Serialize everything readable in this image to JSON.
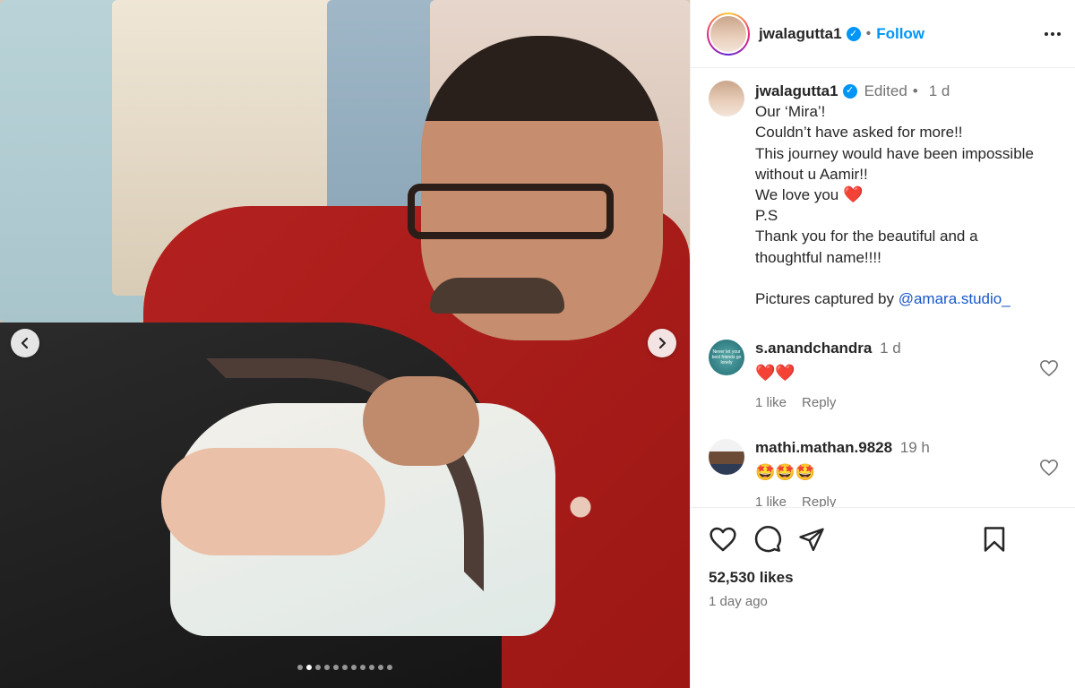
{
  "post": {
    "username": "jwalagutta1",
    "follow_label": "Follow",
    "separator": "•"
  },
  "caption": {
    "username": "jwalagutta1",
    "edited": "Edited",
    "time": "1 d",
    "lines": [
      "Our ‘Mira’!",
      "Couldn’t have asked for more!!",
      "This journey would have been impossible",
      "without u Aamir!!",
      "We love you",
      "P.S",
      "Thank you for the beautiful and a",
      "thoughtful name!!!!"
    ],
    "love_emoji": "❤️",
    "credit_prefix": "Pictures captured by ",
    "credit_mention": "@amara.studio_"
  },
  "comments": [
    {
      "username": "s.anandchandra",
      "time": "1 d",
      "text": "❤️❤️",
      "likes": "1 like",
      "reply": "Reply",
      "avatar_text": "Never let your best friends go lonely"
    },
    {
      "username": "mathi.mathan.9828",
      "time": "19 h",
      "text": "🤩🤩🤩",
      "likes": "1 like",
      "reply": "Reply"
    }
  ],
  "stats": {
    "likes": "52,530 likes",
    "date": "1 day ago"
  },
  "carousel": {
    "total_slides": 11,
    "active_index": 1
  },
  "colors": {
    "accent": "#0095f6",
    "mention": "#1a57c9",
    "muted": "#737373",
    "text": "#262626"
  },
  "icons": {
    "prev": "chevron-left-icon",
    "next": "chevron-right-icon",
    "like": "heart-icon",
    "comment": "comment-icon",
    "share": "paper-plane-icon",
    "save": "bookmark-icon",
    "more": "more-horizontal-icon",
    "verified": "verified-badge-icon"
  }
}
